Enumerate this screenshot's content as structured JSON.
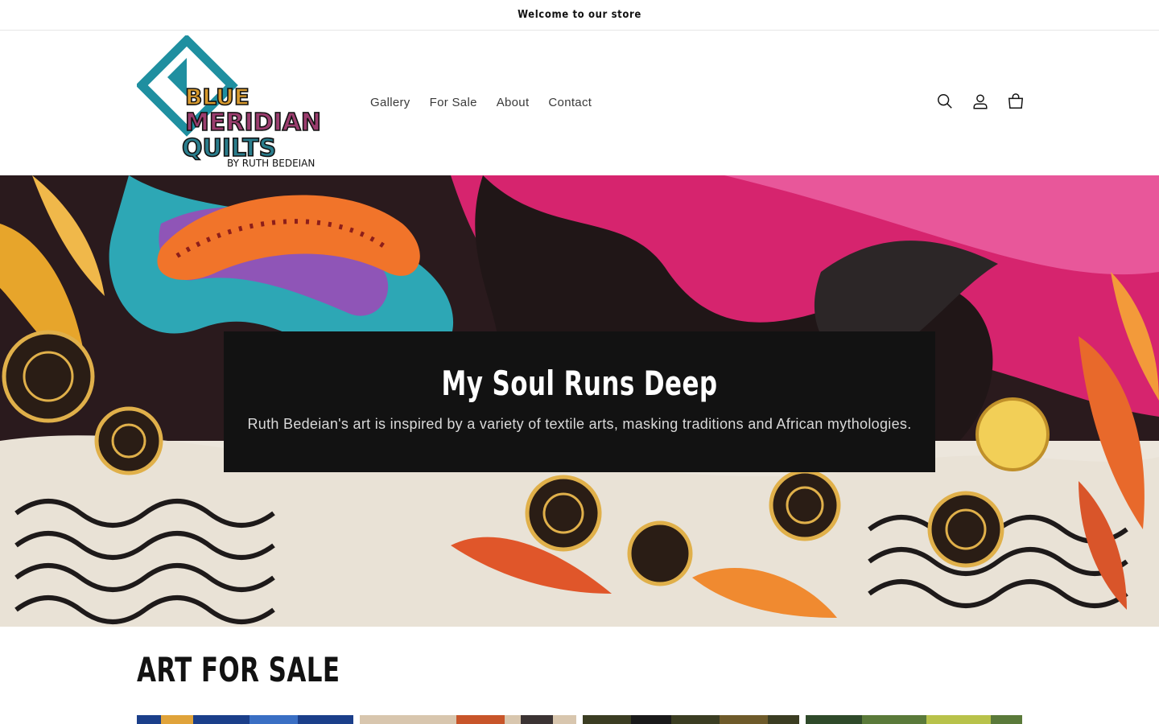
{
  "announcement": {
    "text": "Welcome to our store"
  },
  "brand": {
    "logo_line1": "BLUE",
    "logo_line2": "MERIDIAN",
    "logo_line3": "QUILTS",
    "logo_byline": "BY RUTH BEDEIAN"
  },
  "nav": {
    "items": [
      {
        "label": "Gallery"
      },
      {
        "label": "For Sale"
      },
      {
        "label": "About"
      },
      {
        "label": "Contact"
      }
    ]
  },
  "header_icons": [
    "search-icon",
    "account-icon",
    "cart-icon"
  ],
  "hero": {
    "title": "My Soul Runs Deep",
    "subtitle": "Ruth Bedeian's art is inspired by a variety of textile arts, masking traditions and African mythologies."
  },
  "featured": {
    "title": "ART FOR SALE",
    "product_colors": [
      "#1b3f8a",
      "#c8552a",
      "#3b3d22",
      "#5a7a3a"
    ]
  },
  "colors": {
    "accent_teal": "#1f8fa0",
    "text": "#121212",
    "hero_box": "#121212"
  }
}
